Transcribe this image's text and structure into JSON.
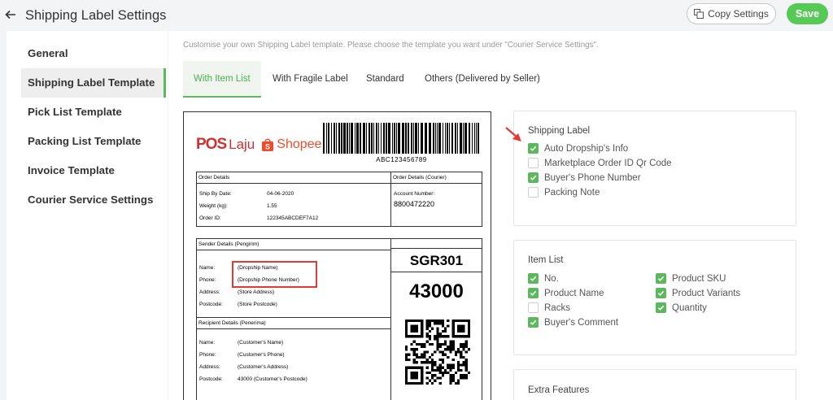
{
  "header": {
    "title": "Shipping Label Settings",
    "copy_label": "Copy Settings",
    "save_label": "Save"
  },
  "sidebar": {
    "items": [
      {
        "label": "General"
      },
      {
        "label": "Shipping Label Template"
      },
      {
        "label": "Pick List Template"
      },
      {
        "label": "Packing List Template"
      },
      {
        "label": "Invoice Template"
      },
      {
        "label": "Courier Service Settings"
      }
    ],
    "active_index": 1
  },
  "main": {
    "description": "Customise your own Shipping Label template. Please choose the template you want under \"Courier Service Settings\".",
    "tabs": [
      {
        "label": "With Item List"
      },
      {
        "label": "With Fragile Label"
      },
      {
        "label": "Standard"
      },
      {
        "label": "Others (Delivered by Seller)"
      }
    ],
    "active_tab": 0
  },
  "label": {
    "logo_pos": "POS",
    "logo_laju": "Laju",
    "logo_shopee": "Shopee",
    "barcode_text": "ABC123456789",
    "order_details": {
      "title": "Order Details",
      "ship_by_label": "Ship By Date:",
      "ship_by_value": "04-06-2020",
      "weight_label": "Weight (kg):",
      "weight_value": "1.55",
      "order_id_label": "Order ID:",
      "order_id_value": "122345ABCDEF7A12"
    },
    "courier_details": {
      "title": "Order Details (Courier)",
      "account_label": "Account Number:",
      "account_value": "8800472220"
    },
    "sender": {
      "title": "Sender Details (Pengirim)",
      "name_label": "Name:",
      "name_value": "(Dropship Name)",
      "phone_label": "Phone:",
      "phone_value": "(Dropship Phone Number)",
      "address_label": "Address:",
      "address_value": "(Store Address)",
      "postcode_label": "Postcode:",
      "postcode_value": "(Store Postcode)"
    },
    "recipient": {
      "title": "Recipient Details (Penerima)",
      "name_label": "Name:",
      "name_value": "(Customer's Name)",
      "phone_label": "Phone:",
      "phone_value": "(Customer's Phone)",
      "address_label": "Address:",
      "address_value": "(Customer's Address)",
      "postcode_label": "Postcode:",
      "postcode_value": "43000 (Customer's Postcode)"
    },
    "route_code": "SGR301",
    "postcode_big": "43000"
  },
  "shipping_label_panel": {
    "title": "Shipping Label",
    "options": [
      {
        "label": "Auto Dropship's Info",
        "checked": true
      },
      {
        "label": "Marketplace Order ID Qr Code",
        "checked": false
      },
      {
        "label": "Buyer's Phone Number",
        "checked": true
      },
      {
        "label": "Packing Note",
        "checked": false
      }
    ]
  },
  "item_list_panel": {
    "title": "Item List",
    "left_options": [
      {
        "label": "No.",
        "checked": true
      },
      {
        "label": "Product Name",
        "checked": true
      },
      {
        "label": "Racks",
        "checked": false
      },
      {
        "label": "Buyer's Comment",
        "checked": true
      }
    ],
    "right_options": [
      {
        "label": "Product SKU",
        "checked": true
      },
      {
        "label": "Product Variants",
        "checked": true
      },
      {
        "label": "Quantity",
        "checked": true
      }
    ]
  },
  "extra_panel": {
    "title": "Extra Features"
  },
  "colors": {
    "accent": "#5cb85c",
    "highlight": "#e53935",
    "pos_red": "#d32f2f",
    "shopee_orange": "#ee4d2d"
  }
}
